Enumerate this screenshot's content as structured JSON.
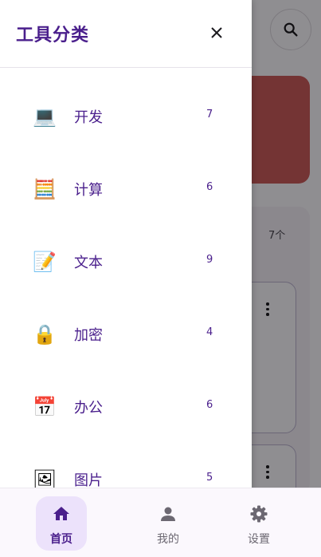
{
  "drawer": {
    "title": "工具分类",
    "categories": [
      {
        "icon": "💻",
        "icon_name": "laptop-icon",
        "label": "开发",
        "count": "7"
      },
      {
        "icon": "🧮",
        "icon_name": "abacus-icon",
        "label": "计算",
        "count": "6"
      },
      {
        "icon": "📝",
        "icon_name": "memo-icon",
        "label": "文本",
        "count": "9"
      },
      {
        "icon": "🔒",
        "icon_name": "lock-icon",
        "label": "加密",
        "count": "4"
      },
      {
        "icon": "📅",
        "icon_name": "calendar-icon",
        "label": "办公",
        "count": "6"
      },
      {
        "icon": "🖼",
        "icon_name": "framed-picture-icon",
        "label": "图片",
        "count": "5"
      }
    ]
  },
  "background": {
    "count_label": "7个"
  },
  "bottom_nav": {
    "items": [
      {
        "label": "首页",
        "icon_name": "home-icon",
        "active": true
      },
      {
        "label": "我的",
        "icon_name": "person-icon",
        "active": false
      },
      {
        "label": "设置",
        "icon_name": "gear-icon",
        "active": false
      }
    ]
  },
  "colors": {
    "accent": "#4a1f8c",
    "active_pill": "#ece2fb",
    "banner": "#c85a5a"
  }
}
